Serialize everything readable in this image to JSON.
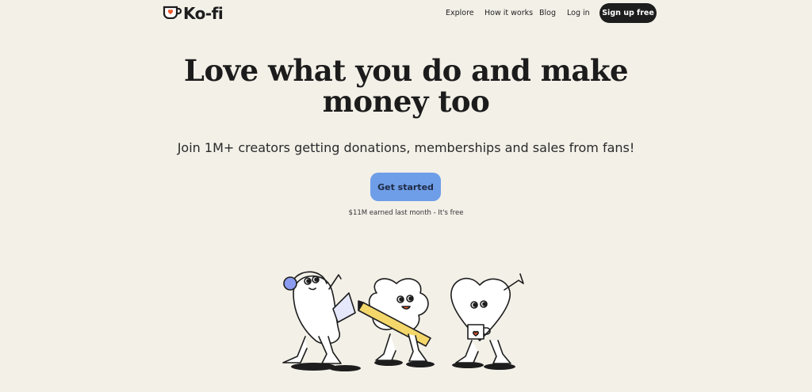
{
  "nav": {
    "logo_text": "Ko-fi",
    "links": [
      "Explore",
      "How it works",
      "Blog",
      "Log in"
    ],
    "signup_label": "Sign up free"
  },
  "hero": {
    "title_line1": "Love what you do and make",
    "title_line2": "money too",
    "subtitle": "Join 1M+ creators getting donations, memberships and sales from fans!",
    "cta_label": "Get started",
    "cta_note": "$11M earned last month - It's free"
  },
  "colors": {
    "background": "#f3f0e8",
    "cta": "#6f9ee8",
    "signup": "#1d1d1d",
    "accent": "#ef5b2e",
    "pencil": "#f3d76b",
    "headphones": "#8a9bf0"
  },
  "illustration": {
    "characters": [
      "headphone-laptop-character",
      "pencil-character",
      "heart-mug-character"
    ]
  }
}
